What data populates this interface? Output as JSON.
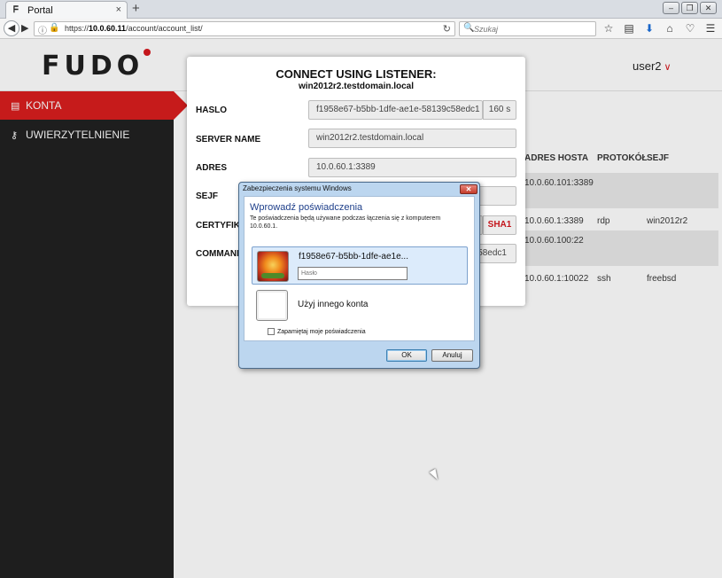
{
  "browser": {
    "tab_title": "Portal",
    "tab_close": "×",
    "new_tab": "+",
    "url_prefix": "https://",
    "url_host": "10.0.60.11",
    "url_path": "/account/account_list/",
    "search_placeholder": "Szukaj",
    "window_buttons": [
      "–",
      "❐",
      "✕"
    ],
    "toolbar_icons": [
      "star-icon",
      "reading-list-icon",
      "download-icon",
      "home-icon",
      "pocket-icon",
      "menu-icon"
    ]
  },
  "app": {
    "logo": "FUDO",
    "user": "user2",
    "accent_color": "#c61b1b"
  },
  "sidebar": {
    "items": [
      {
        "label": "KONTA",
        "icon": "book-icon",
        "active": true
      },
      {
        "label": "UWIERZYTELNIENIE",
        "icon": "key-icon",
        "active": false
      }
    ]
  },
  "table": {
    "headers": [
      "ADRES HOSTA",
      "PROTOKÓŁ",
      "SEJF"
    ],
    "rows": [
      {
        "host": "10.0.60.101:3389",
        "protocol": "",
        "safe": ""
      },
      {
        "host": "10.0.60.1:3389",
        "protocol": "rdp",
        "safe": "win2012r2"
      },
      {
        "host": "10.0.60.100:22",
        "protocol": "",
        "safe": ""
      },
      {
        "host": "10.0.60.1:10022",
        "protocol": "ssh",
        "safe": "freebsd"
      }
    ]
  },
  "modal": {
    "title": "CONNECT USING LISTENER:",
    "subtitle": "win2012r2.testdomain.local",
    "password_label": "HASLO",
    "password_value": "f1958e67-b5bb-1dfe-ae1e-58139c58edc1",
    "password_ttl": "160 s",
    "server_label": "SERVER NAME",
    "server_value": "win2012r2.testdomain.local",
    "address_label": "ADRES",
    "address_value": "10.0.60.1:3389",
    "safe_label": "SEJF",
    "cert_label": "CERTYFIKAT",
    "cert_addon": "SHA1",
    "command_label": "COMMAND",
    "command_value_tail": "58edc1"
  },
  "win_dialog": {
    "title": "Zabezpieczenia systemu Windows",
    "heading": "Wprowadź poświadczenia",
    "description": "Te poświadczenia będą używane podczas łączenia się z komputerem 10.0.60.1.",
    "credential_name": "f1958e67-b5bb-1dfe-ae1e...",
    "password_placeholder": "Hasło",
    "other_account": "Użyj innego konta",
    "remember": "Zapamiętaj moje poświadczenia",
    "ok": "OK",
    "cancel": "Anuluj"
  }
}
